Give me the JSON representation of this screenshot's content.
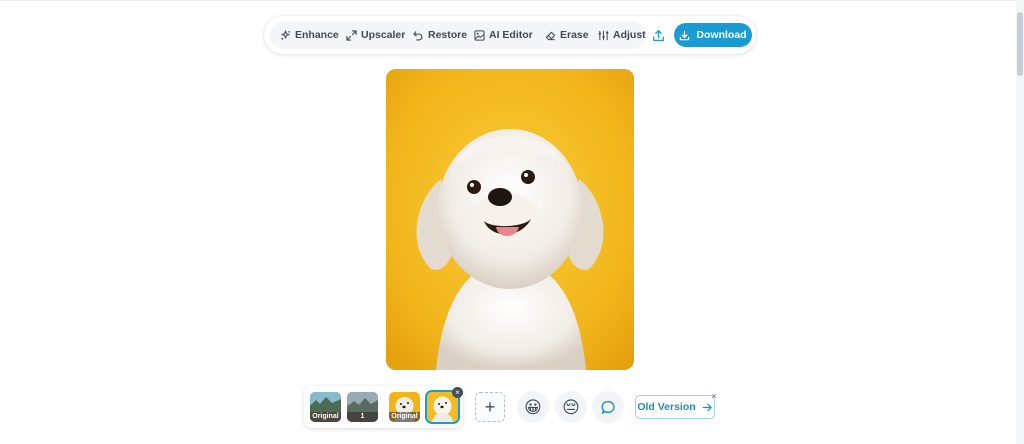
{
  "toolbar": {
    "tools": [
      {
        "label": "Enhance",
        "icon": "sparkles-icon"
      },
      {
        "label": "Upscaler",
        "icon": "expand-arrows-icon"
      },
      {
        "label": "Restore",
        "icon": "undo-icon"
      },
      {
        "label": "AI Editor",
        "icon": "image-edit-icon"
      },
      {
        "label": "Erase",
        "icon": "eraser-icon"
      },
      {
        "label": "Adjust",
        "icon": "sliders-icon"
      }
    ],
    "upload_icon": "upload-icon",
    "download_label": "Download",
    "accent_color": "#1a9bd4"
  },
  "canvas": {
    "image_subject": "white dog on yellow background"
  },
  "thumbnails": [
    {
      "label": "Original",
      "kind": "landscape"
    },
    {
      "label": "1",
      "kind": "landscape"
    },
    {
      "label": "Original",
      "kind": "dog"
    },
    {
      "label": "",
      "kind": "dog",
      "selected": true
    }
  ],
  "remove_symbol": "×",
  "add_symbol": "+",
  "feedback": {
    "happy_emoji": "😀",
    "sad_emoji": "😔",
    "comment_icon": "chat-bubble-icon"
  },
  "old_version": {
    "label": "Old Version",
    "close_symbol": "×"
  }
}
